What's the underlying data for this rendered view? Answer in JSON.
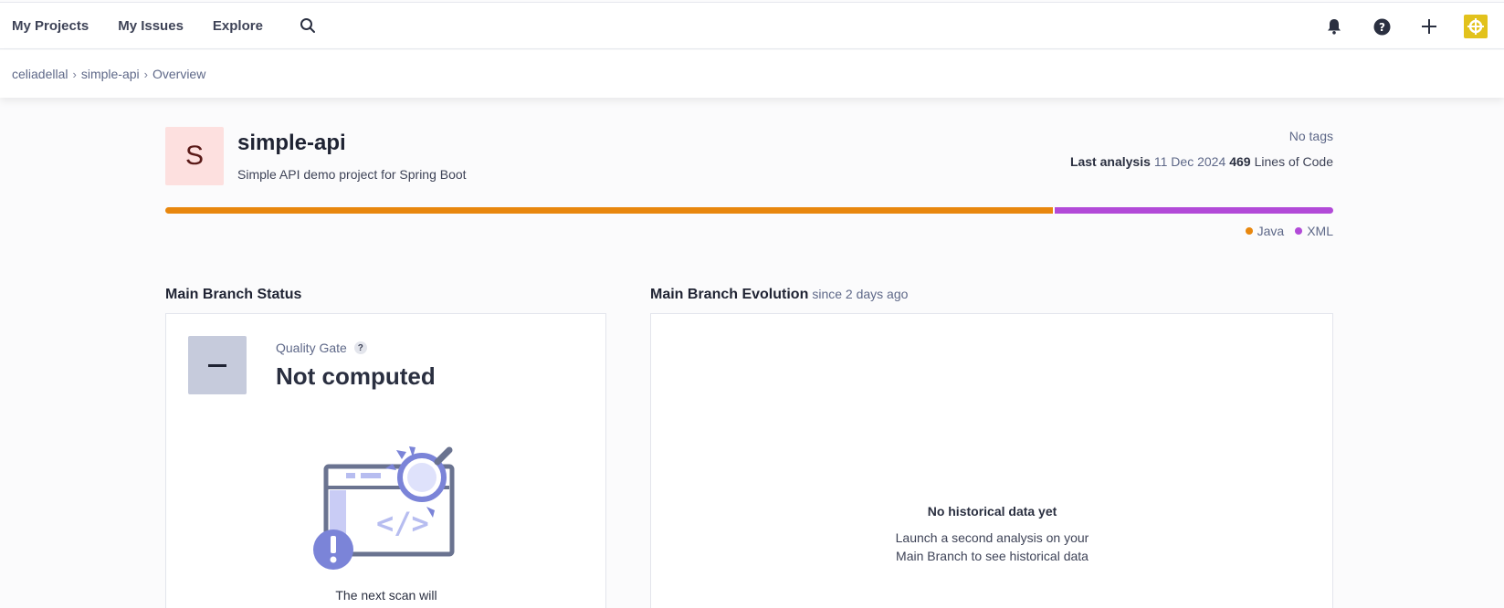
{
  "nav": {
    "items": [
      "My Projects",
      "My Issues",
      "Explore"
    ],
    "icons": [
      "search-icon",
      "bell-icon",
      "help-icon",
      "plus-icon",
      "avatar"
    ]
  },
  "breadcrumb": {
    "org": "celiadellal",
    "project": "simple-api",
    "page": "Overview"
  },
  "project": {
    "initial": "S",
    "name": "simple-api",
    "description": "Simple API demo project for Spring Boot",
    "tags": "No tags",
    "last_analysis_label": "Last analysis",
    "last_analysis_date": "11 Dec 2024",
    "loc_value": "469",
    "loc_label": "Lines of Code"
  },
  "languages": [
    {
      "name": "Java",
      "fraction": 0.76,
      "color": "#e8870e"
    },
    {
      "name": "XML",
      "fraction": 0.24,
      "color": "#b24ad8"
    }
  ],
  "status": {
    "title": "Main Branch Status",
    "qg_label": "Quality Gate",
    "qg_help": "?",
    "qg_value": "Not computed",
    "next_scan": "The next scan will"
  },
  "evolution": {
    "title": "Main Branch Evolution",
    "since": "since 2 days ago",
    "empty_title": "No historical data yet",
    "empty_line1": "Launch a second analysis on your",
    "empty_line2": "Main Branch to see historical data"
  }
}
